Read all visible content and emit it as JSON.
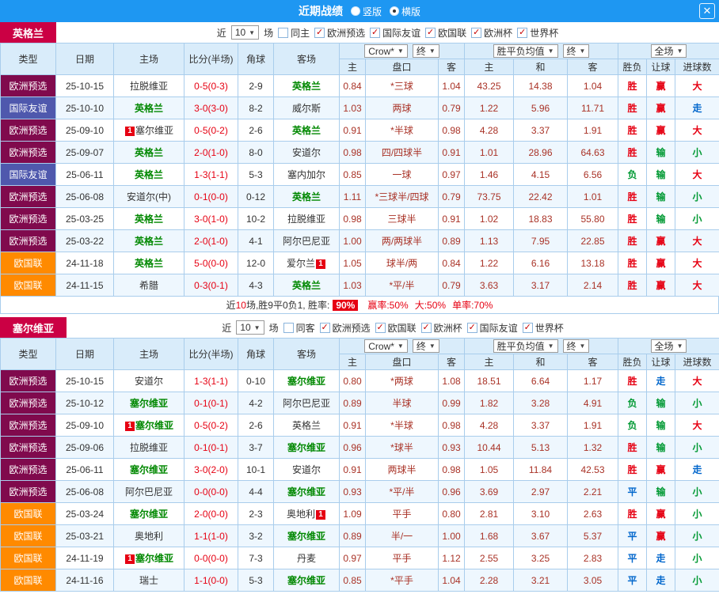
{
  "topbar": {
    "title": "近期战绩",
    "options": [
      {
        "label": "竖版",
        "selected": false
      },
      {
        "label": "横版",
        "selected": true
      }
    ],
    "close_icon": "✕"
  },
  "colors": {
    "header_bar": "#1e97f2",
    "team_label_bg": "#cb0044",
    "type_map": {
      "欧洲预选": "#800a4d",
      "国际友谊": "#4f58ad",
      "欧国联": "#ff8a00"
    },
    "result_map": {
      "胜": "#e60012",
      "负": "#009933",
      "平": "#0066cc",
      "赢": "#e60012",
      "输": "#009933",
      "走": "#0066cc",
      "大": "#e60012",
      "小": "#009933"
    },
    "focus_team": "#008800",
    "score": "#e60012",
    "odds": "#a93226",
    "badge": "#e60012"
  },
  "table_header": {
    "main_cols": [
      "类型",
      "日期",
      "主场",
      "比分(半场)",
      "角球",
      "客场"
    ],
    "odds_select": "Crow*",
    "final_select": "终",
    "avg_select": "胜平负均值",
    "scope_select": "全场",
    "sub_cols": [
      "主",
      "盘口",
      "客",
      "主",
      "和",
      "客",
      "胜负",
      "让球",
      "进球数"
    ]
  },
  "sections": [
    {
      "team": "英格兰",
      "filters": {
        "near": "近",
        "count": "10",
        "unit": "场",
        "same": "同主",
        "competitions": [
          "欧洲预选",
          "国际友谊",
          "欧国联",
          "欧洲杯",
          "世界杯"
        ]
      },
      "rows": [
        {
          "lg": "欧洲预选",
          "date": "25-10-15",
          "home": "拉脱维亚",
          "score": "0-5(0-3)",
          "cr": "2-9",
          "away": "英格兰",
          "af": true,
          "o1": "0.84",
          "hc": "*三球",
          "o2": "1.04",
          "e1": "43.25",
          "e2": "14.38",
          "e3": "1.04",
          "r1": "胜",
          "r2": "赢",
          "r3": "大"
        },
        {
          "lg": "国际友谊",
          "date": "25-10-10",
          "home": "英格兰",
          "hf": true,
          "score": "3-0(3-0)",
          "cr": "8-2",
          "away": "威尔斯",
          "o1": "1.03",
          "hc": "两球",
          "o2": "0.79",
          "e1": "1.22",
          "e2": "5.96",
          "e3": "11.71",
          "r1": "胜",
          "r2": "赢",
          "r3": "走"
        },
        {
          "lg": "欧洲预选",
          "date": "25-09-10",
          "home": "塞尔维亚",
          "hb": true,
          "score": "0-5(0-2)",
          "cr": "2-6",
          "away": "英格兰",
          "af": true,
          "o1": "0.91",
          "hc": "*半球",
          "o2": "0.98",
          "e1": "4.28",
          "e2": "3.37",
          "e3": "1.91",
          "r1": "胜",
          "r2": "赢",
          "r3": "大"
        },
        {
          "lg": "欧洲预选",
          "date": "25-09-07",
          "home": "英格兰",
          "hf": true,
          "score": "2-0(1-0)",
          "cr": "8-0",
          "away": "安道尔",
          "o1": "0.98",
          "hc": "四/四球半",
          "o2": "0.91",
          "e1": "1.01",
          "e2": "28.96",
          "e3": "64.63",
          "r1": "胜",
          "r2": "输",
          "r3": "小"
        },
        {
          "lg": "国际友谊",
          "date": "25-06-11",
          "home": "英格兰",
          "hf": true,
          "score": "1-3(1-1)",
          "cr": "5-3",
          "away": "塞内加尔",
          "o1": "0.85",
          "hc": "一球",
          "o2": "0.97",
          "e1": "1.46",
          "e2": "4.15",
          "e3": "6.56",
          "r1": "负",
          "r2": "输",
          "r3": "大"
        },
        {
          "lg": "欧洲预选",
          "date": "25-06-08",
          "home": "安道尔(中)",
          "score": "0-1(0-0)",
          "cr": "0-12",
          "away": "英格兰",
          "af": true,
          "o1": "1.11",
          "hc": "*三球半/四球",
          "o2": "0.79",
          "e1": "73.75",
          "e2": "22.42",
          "e3": "1.01",
          "r1": "胜",
          "r2": "输",
          "r3": "小"
        },
        {
          "lg": "欧洲预选",
          "date": "25-03-25",
          "home": "英格兰",
          "hf": true,
          "score": "3-0(1-0)",
          "cr": "10-2",
          "away": "拉脱维亚",
          "o1": "0.98",
          "hc": "三球半",
          "o2": "0.91",
          "e1": "1.02",
          "e2": "18.83",
          "e3": "55.80",
          "r1": "胜",
          "r2": "输",
          "r3": "小"
        },
        {
          "lg": "欧洲预选",
          "date": "25-03-22",
          "home": "英格兰",
          "hf": true,
          "score": "2-0(1-0)",
          "cr": "4-1",
          "away": "阿尔巴尼亚",
          "o1": "1.00",
          "hc": "两/两球半",
          "o2": "0.89",
          "e1": "1.13",
          "e2": "7.95",
          "e3": "22.85",
          "r1": "胜",
          "r2": "赢",
          "r3": "大"
        },
        {
          "lg": "欧国联",
          "date": "24-11-18",
          "home": "英格兰",
          "hf": true,
          "score": "5-0(0-0)",
          "cr": "12-0",
          "away": "爱尔兰",
          "ab": true,
          "o1": "1.05",
          "hc": "球半/两",
          "o2": "0.84",
          "e1": "1.22",
          "e2": "6.16",
          "e3": "13.18",
          "r1": "胜",
          "r2": "赢",
          "r3": "大"
        },
        {
          "lg": "欧国联",
          "date": "24-11-15",
          "home": "希腊",
          "score": "0-3(0-1)",
          "cr": "4-3",
          "away": "英格兰",
          "af": true,
          "o1": "1.03",
          "hc": "*平/半",
          "o2": "0.79",
          "e1": "3.63",
          "e2": "3.17",
          "e3": "2.14",
          "r1": "胜",
          "r2": "赢",
          "r3": "大"
        }
      ],
      "summary_segments": [
        {
          "text": "近",
          "color": "#333333"
        },
        {
          "text": "10",
          "color": "#e60012"
        },
        {
          "text": "场,胜9平0负1, 胜率:",
          "color": "#333333"
        },
        {
          "text": "90%",
          "badge": true
        },
        {
          "text": "赢率:50%",
          "color": "#e60012",
          "ml": true
        },
        {
          "text": "大:50%",
          "color": "#e60012",
          "ml": true
        },
        {
          "text": "单率:70%",
          "color": "#e60012",
          "ml": true
        }
      ]
    },
    {
      "team": "塞尔维亚",
      "filters": {
        "near": "近",
        "count": "10",
        "unit": "场",
        "same": "同客",
        "competitions": [
          "欧洲预选",
          "欧国联",
          "欧洲杯",
          "国际友谊",
          "世界杯"
        ]
      },
      "rows": [
        {
          "lg": "欧洲预选",
          "date": "25-10-15",
          "home": "安道尔",
          "score": "1-3(1-1)",
          "cr": "0-10",
          "away": "塞尔维亚",
          "af": true,
          "o1": "0.80",
          "hc": "*两球",
          "o2": "1.08",
          "e1": "18.51",
          "e2": "6.64",
          "e3": "1.17",
          "r1": "胜",
          "r2": "走",
          "r3": "大"
        },
        {
          "lg": "欧洲预选",
          "date": "25-10-12",
          "home": "塞尔维亚",
          "hf": true,
          "score": "0-1(0-1)",
          "cr": "4-2",
          "away": "阿尔巴尼亚",
          "o1": "0.89",
          "hc": "半球",
          "o2": "0.99",
          "e1": "1.82",
          "e2": "3.28",
          "e3": "4.91",
          "r1": "负",
          "r2": "输",
          "r3": "小"
        },
        {
          "lg": "欧洲预选",
          "date": "25-09-10",
          "home": "塞尔维亚",
          "hf": true,
          "hb": true,
          "score": "0-5(0-2)",
          "cr": "2-6",
          "away": "英格兰",
          "o1": "0.91",
          "hc": "*半球",
          "o2": "0.98",
          "e1": "4.28",
          "e2": "3.37",
          "e3": "1.91",
          "r1": "负",
          "r2": "输",
          "r3": "大"
        },
        {
          "lg": "欧洲预选",
          "date": "25-09-06",
          "home": "拉脱维亚",
          "score": "0-1(0-1)",
          "cr": "3-7",
          "away": "塞尔维亚",
          "af": true,
          "o1": "0.96",
          "hc": "*球半",
          "o2": "0.93",
          "e1": "10.44",
          "e2": "5.13",
          "e3": "1.32",
          "r1": "胜",
          "r2": "输",
          "r3": "小"
        },
        {
          "lg": "欧洲预选",
          "date": "25-06-11",
          "home": "塞尔维亚",
          "hf": true,
          "score": "3-0(2-0)",
          "cr": "10-1",
          "away": "安道尔",
          "o1": "0.91",
          "hc": "两球半",
          "o2": "0.98",
          "e1": "1.05",
          "e2": "11.84",
          "e3": "42.53",
          "r1": "胜",
          "r2": "赢",
          "r3": "走"
        },
        {
          "lg": "欧洲预选",
          "date": "25-06-08",
          "home": "阿尔巴尼亚",
          "score": "0-0(0-0)",
          "cr": "4-4",
          "away": "塞尔维亚",
          "af": true,
          "o1": "0.93",
          "hc": "*平/半",
          "o2": "0.96",
          "e1": "3.69",
          "e2": "2.97",
          "e3": "2.21",
          "r1": "平",
          "r2": "输",
          "r3": "小"
        },
        {
          "lg": "欧国联",
          "date": "25-03-24",
          "home": "塞尔维亚",
          "hf": true,
          "score": "2-0(0-0)",
          "cr": "2-3",
          "away": "奥地利",
          "ab": true,
          "o1": "1.09",
          "hc": "平手",
          "o2": "0.80",
          "e1": "2.81",
          "e2": "3.10",
          "e3": "2.63",
          "r1": "胜",
          "r2": "赢",
          "r3": "小"
        },
        {
          "lg": "欧国联",
          "date": "25-03-21",
          "home": "奥地利",
          "score": "1-1(1-0)",
          "cr": "3-2",
          "away": "塞尔维亚",
          "af": true,
          "o1": "0.89",
          "hc": "半/一",
          "o2": "1.00",
          "e1": "1.68",
          "e2": "3.67",
          "e3": "5.37",
          "r1": "平",
          "r2": "赢",
          "r3": "小"
        },
        {
          "lg": "欧国联",
          "date": "24-11-19",
          "home": "塞尔维亚",
          "hf": true,
          "hb": true,
          "score": "0-0(0-0)",
          "cr": "7-3",
          "away": "丹麦",
          "o1": "0.97",
          "hc": "平手",
          "o2": "1.12",
          "e1": "2.55",
          "e2": "3.25",
          "e3": "2.83",
          "r1": "平",
          "r2": "走",
          "r3": "小"
        },
        {
          "lg": "欧国联",
          "date": "24-11-16",
          "home": "瑞士",
          "score": "1-1(0-0)",
          "cr": "5-3",
          "away": "塞尔维亚",
          "af": true,
          "o1": "0.85",
          "hc": "*平手",
          "o2": "1.04",
          "e1": "2.28",
          "e2": "3.21",
          "e3": "3.05",
          "r1": "平",
          "r2": "走",
          "r3": "小"
        }
      ]
    }
  ]
}
